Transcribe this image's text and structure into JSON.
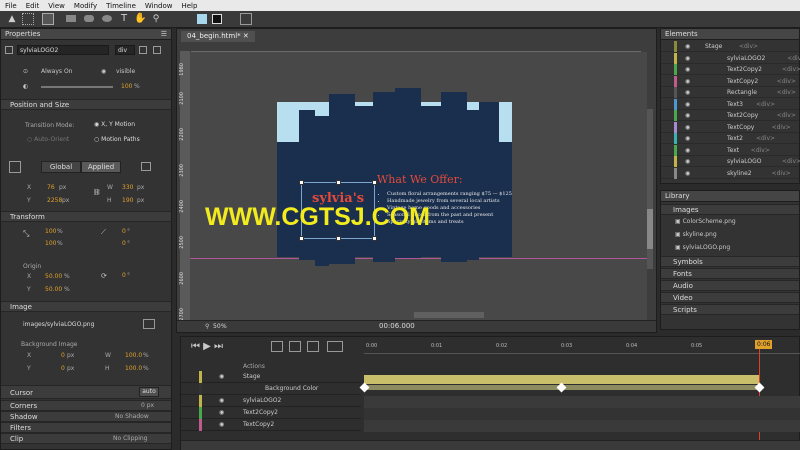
{
  "menu": [
    "File",
    "Edit",
    "View",
    "Modify",
    "Timeline",
    "Window",
    "Help"
  ],
  "properties": {
    "title": "Properties",
    "element_name": "sylviaLOGO2",
    "element_type": "div",
    "always_on": "Always On",
    "visible": "visible",
    "opacity": "100",
    "opacity_unit": "%",
    "position_size": "Position and Size",
    "transition_mode_label": "Transition Mode:",
    "transition_mode": "X, Y Motion",
    "auto_orient": "Auto-Orient",
    "motion_paths": "Motion Paths",
    "tab_global": "Global",
    "tab_applied": "Applied",
    "x_label": "X",
    "x_value": "76",
    "x_unit": "px",
    "w_label": "W",
    "w_value": "330",
    "w_unit": "px",
    "y_label": "Y",
    "y_value": "2258",
    "y_unit": "px",
    "h_label": "H",
    "h_value": "190",
    "h_unit": "px",
    "transform": "Transform",
    "scale_x": "100",
    "scale_y": "100",
    "scale_unit": "%",
    "skew_x": "0",
    "skew_y": "0",
    "deg": "°",
    "origin": "Origin",
    "origin_x_label": "X",
    "origin_x": "50.00",
    "origin_y_label": "Y",
    "origin_y": "50.00",
    "rotate": "0",
    "image": "Image",
    "image_path": "images/sylviaLOGO.png",
    "bg_image": "Background Image",
    "bg_x": "0",
    "bg_y": "0",
    "bg_unit": "px",
    "bg_w": "100.0",
    "bg_h": "100.0",
    "bg_pct": "%",
    "cursor": "Cursor",
    "cursor_value": "auto",
    "corners": "Corners",
    "corners_value": "0 px",
    "shadow": "Shadow",
    "shadow_value": "No Shadow",
    "filters": "Filters",
    "clip": "Clip",
    "clip_value": "No Clipping"
  },
  "document": {
    "tab": "04_begin.html*",
    "zoom": "50",
    "zoom_unit": "%",
    "time": "00:06.000",
    "ruler_v": [
      "1980",
      "2100",
      "2200",
      "2300",
      "2400",
      "2500",
      "2600",
      "2700"
    ],
    "scene_heading": "What We Offer:",
    "bullets": [
      "Custom floral arrangements ranging $75 — $125",
      "Handmade jewelry from several local artists",
      "Vintage home goods and accessories",
      "Seasonal decor from the past and present",
      "Specialty gift items and treats"
    ],
    "logo_text": "sylvia's",
    "watermark": "WWW.CGTSJ.COM"
  },
  "elements": {
    "title": "Elements",
    "items": [
      {
        "name": "Stage",
        "tag": "<div>",
        "color": "#8a8a3a"
      },
      {
        "name": "sylviaLOGO2",
        "tag": "<div>",
        "color": "#c2b44a"
      },
      {
        "name": "Text2Copy2",
        "tag": "<div>",
        "color": "#49a84a"
      },
      {
        "name": "TextCopy2",
        "tag": "<div>",
        "color": "#c05c8c"
      },
      {
        "name": "Rectangle",
        "tag": "<div>",
        "color": "#555555"
      },
      {
        "name": "Text3",
        "tag": "<div>",
        "color": "#4a9ad0"
      },
      {
        "name": "Text2Copy",
        "tag": "<div>",
        "color": "#49a84a"
      },
      {
        "name": "TextCopy",
        "tag": "<div>",
        "color": "#a98ad0"
      },
      {
        "name": "Text2",
        "tag": "<div>",
        "color": "#3bb0b0"
      },
      {
        "name": "Text",
        "tag": "<div>",
        "color": "#49a84a"
      },
      {
        "name": "sylviaLOGO",
        "tag": "<div>",
        "color": "#c2b44a"
      },
      {
        "name": "skyline2",
        "tag": "<div>",
        "color": "#888888"
      }
    ]
  },
  "library": {
    "title": "Library",
    "images_label": "Images",
    "files": [
      "ColorScheme.png",
      "skyline.png",
      "sylviaLOGO.png"
    ],
    "sections": [
      "Symbols",
      "Fonts",
      "Audio",
      "Video",
      "Scripts"
    ]
  },
  "timeline": {
    "actions": "Actions",
    "ticks": [
      "0:00",
      "0:01",
      "0:02",
      "0:03",
      "0:04",
      "0:05",
      "0:06"
    ],
    "current_badge": "0:06",
    "rows": [
      {
        "name": "Stage",
        "color": "#c2b44a"
      },
      {
        "name": "Background Color",
        "color": "#333333"
      },
      {
        "name": "sylviaLOGO2",
        "color": "#c2b44a"
      },
      {
        "name": "Text2Copy2",
        "color": "#49a84a"
      },
      {
        "name": "TextCopy2",
        "color": "#c05c8c"
      }
    ]
  }
}
